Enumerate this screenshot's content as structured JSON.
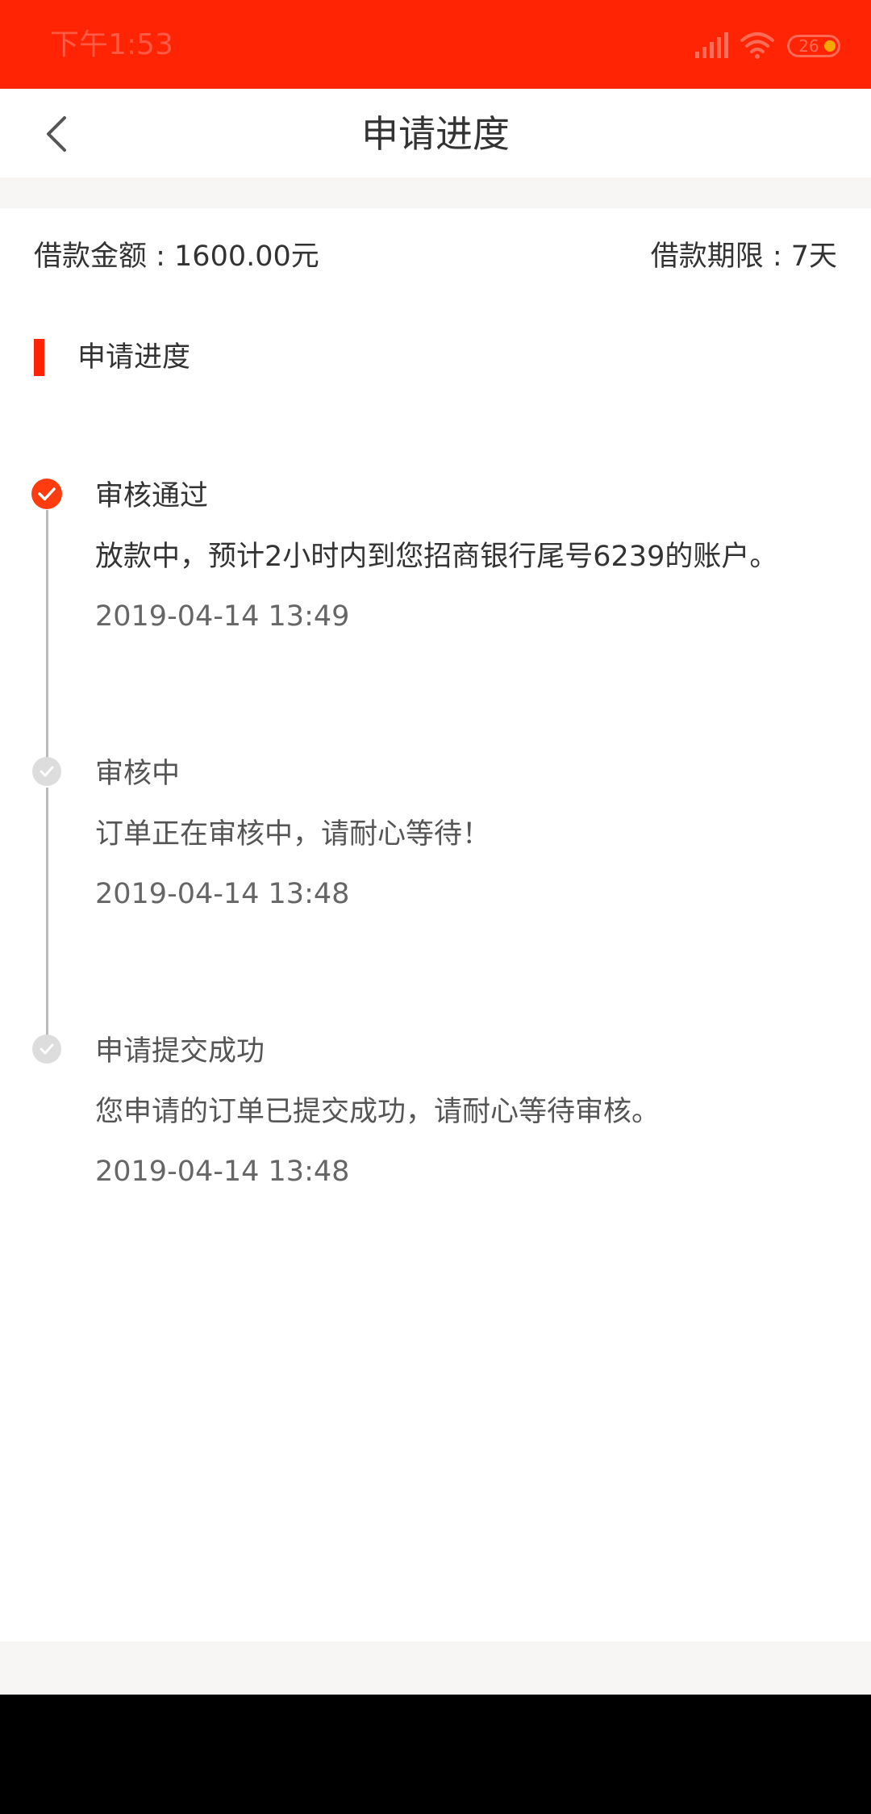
{
  "status_bar": {
    "time": "下午1:53",
    "battery": "26",
    "background_color": "#ff2404"
  },
  "header": {
    "back_icon": "chevron-left-icon",
    "title": "申请进度"
  },
  "loan": {
    "amount": "借款金额 : 1600.00元",
    "term": "借款期限 : 7天"
  },
  "section": {
    "title": "申请进度",
    "accent_color": "#ff2404"
  },
  "timeline": [
    {
      "status": "审核通过",
      "description": "放款中，预计2小时内到您招商银行尾号6239的账户。",
      "time": "2019-04-14 13:49",
      "icon": "check-circle-icon",
      "icon_color": "#ff3c0f",
      "active": true
    },
    {
      "status": "审核中",
      "description": "订单正在审核中，请耐心等待！",
      "time": "2019-04-14 13:48",
      "icon": "check-circle-icon",
      "icon_color": "#dddddd",
      "active": false
    },
    {
      "status": "申请提交成功",
      "description": "您申请的订单已提交成功，请耐心等待审核。",
      "time": "2019-04-14 13:48",
      "icon": "check-circle-icon",
      "icon_color": "#dddddd",
      "active": false
    }
  ]
}
